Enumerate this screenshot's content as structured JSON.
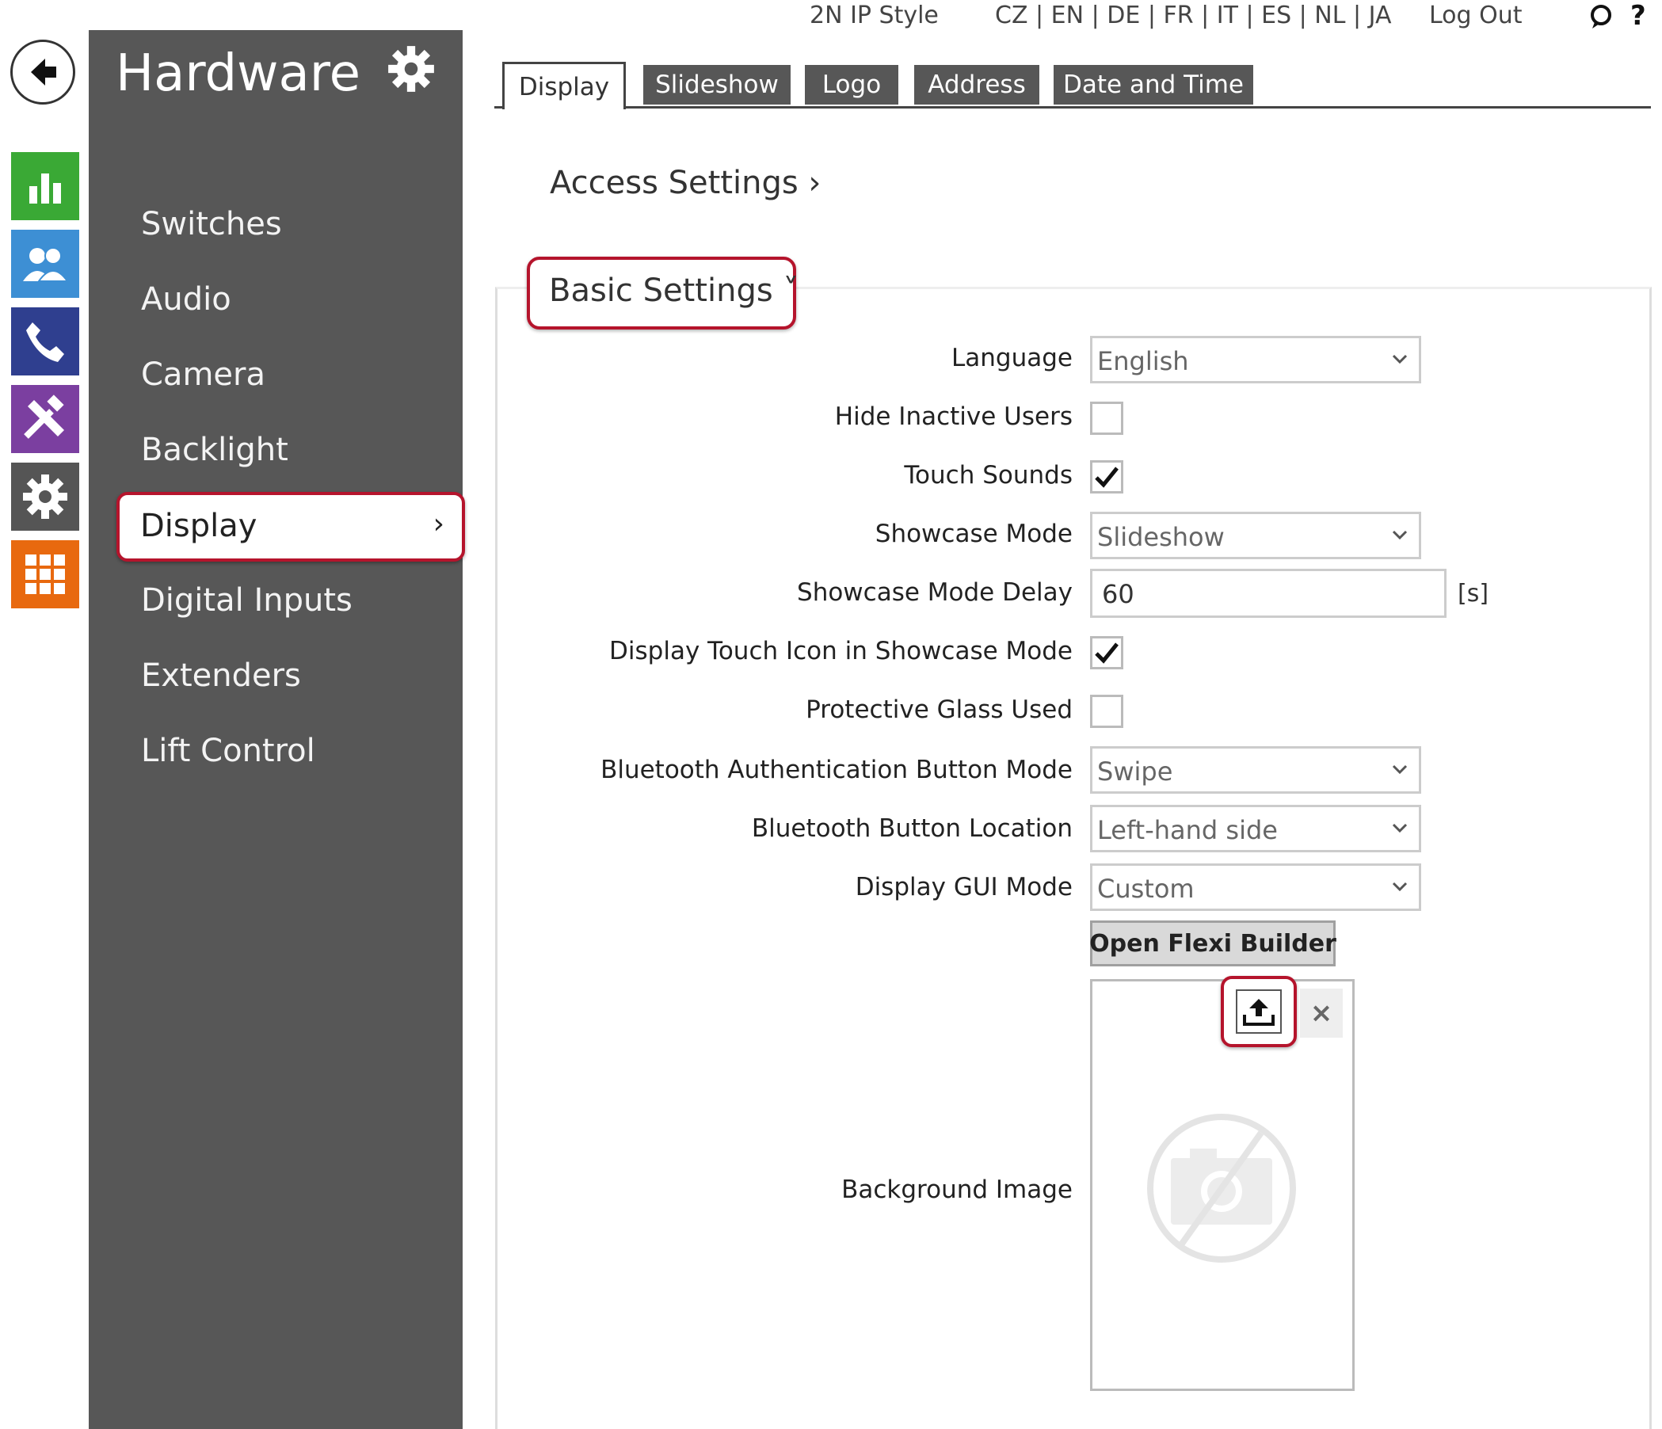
{
  "topbar": {
    "style": "2N IP Style",
    "languages": "CZ | EN | DE | FR | IT | ES | NL | JA",
    "logout": "Log Out",
    "help": "?"
  },
  "rail": {
    "items": [
      {
        "icon": "chart-icon",
        "color": "#3aa935"
      },
      {
        "icon": "users-icon",
        "color": "#3d8fd4"
      },
      {
        "icon": "phone-icon",
        "color": "#2f3f8f"
      },
      {
        "icon": "tools-icon",
        "color": "#7b3fa0"
      },
      {
        "icon": "gear-icon",
        "color": "#555555"
      },
      {
        "icon": "grid-icon",
        "color": "#e8690f"
      }
    ]
  },
  "sidebar": {
    "title": "Hardware",
    "items": [
      {
        "label": "Switches"
      },
      {
        "label": "Audio"
      },
      {
        "label": "Camera"
      },
      {
        "label": "Backlight"
      },
      {
        "label": "Display",
        "active": true
      },
      {
        "label": "Digital Inputs"
      },
      {
        "label": "Extenders"
      },
      {
        "label": "Lift Control"
      }
    ],
    "active_chevron": "›"
  },
  "tabs": [
    {
      "label": "Display",
      "active": true
    },
    {
      "label": "Slideshow"
    },
    {
      "label": "Logo"
    },
    {
      "label": "Address"
    },
    {
      "label": "Date and Time"
    }
  ],
  "sections": {
    "access": "Access Settings ›",
    "basic": "Basic Settings ˅"
  },
  "form": {
    "language": {
      "label": "Language",
      "value": "English"
    },
    "hide_inactive_users": {
      "label": "Hide Inactive Users",
      "checked": false
    },
    "touch_sounds": {
      "label": "Touch Sounds",
      "checked": true
    },
    "showcase_mode": {
      "label": "Showcase Mode",
      "value": "Slideshow"
    },
    "showcase_mode_delay": {
      "label": "Showcase Mode Delay",
      "value": "60",
      "unit": "[s]"
    },
    "display_touch_icon": {
      "label": "Display Touch Icon in Showcase Mode",
      "checked": true
    },
    "protective_glass": {
      "label": "Protective Glass Used",
      "checked": false
    },
    "bt_auth_mode": {
      "label": "Bluetooth Authentication Button Mode",
      "value": "Swipe"
    },
    "bt_button_location": {
      "label": "Bluetooth Button Location",
      "value": "Left-hand side"
    },
    "display_gui_mode": {
      "label": "Display GUI Mode",
      "value": "Custom"
    },
    "open_flexi_builder": "Open Flexi Builder",
    "background_image": {
      "label": "Background Image",
      "remove": "×"
    }
  },
  "colors": {
    "highlight": "#b5142c",
    "sidebar_bg": "#575757"
  }
}
